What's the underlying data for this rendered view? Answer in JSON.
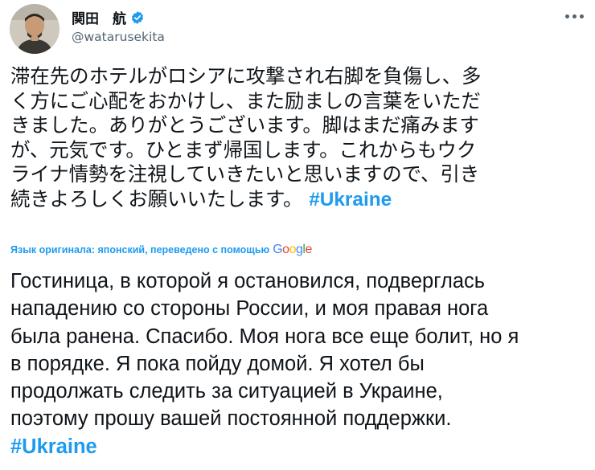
{
  "author": {
    "display_name": "関田　航",
    "handle": "@watarusekita",
    "avatar_icon": "user-avatar",
    "verified_icon": "verified-badge-icon"
  },
  "tweet": {
    "original_lines": [
      "滞在先のホテルがロシアに攻撃され右脚を負傷し、多",
      "く方にご心配をおかけし、また励ましの言葉をいただ",
      "きました。ありがとうございます。脚はまだ痛みます",
      "が、元気です。ひとまず帰国します。これからもウク",
      "ライナ情勢を注視していきたいと思いますので、引き",
      "続きよろしくお願いいたします。"
    ],
    "hashtag": "#Ukraine",
    "translation_note": "Язык оригинала: японский, переведено с помощью",
    "translation_provider": "Google",
    "translation_lines": [
      "Гостиница, в которой я остановился, подверглась",
      "нападению со стороны России, и моя правая нога",
      "была ранена. Спасибо. Моя нога все еще болит, но я",
      "в порядке. Я пока пойду домой. Я хотел бы",
      "продолжать следить за ситуацией в Украине,",
      "поэтому прошу вашей постоянной поддержки."
    ],
    "translation_hashtag": "#Ukraine"
  },
  "colors": {
    "link": "#1d9bf0",
    "text": "#0f1419",
    "secondary": "#536471"
  },
  "icons": {
    "more": "more-options-icon"
  }
}
